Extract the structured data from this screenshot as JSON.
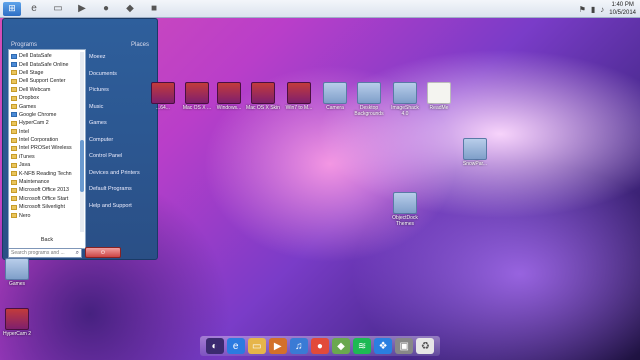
{
  "clock": {
    "time": "1:40 PM",
    "date": "10/5/2014"
  },
  "start_menu": {
    "programs_header": "Programs",
    "places_header": "Places",
    "programs": [
      "Dell DataSafe",
      "Dell DataSafe Online",
      "Dell Stage",
      "Dell Support Center",
      "Dell Webcam",
      "Dropbox",
      "Games",
      "Google Chrome",
      "HyperCam 2",
      "Intel",
      "Intel Corporation",
      "Intel PROSet Wireless",
      "iTunes",
      "Java",
      "K-NFB Reading Techn",
      "Maintenance",
      "Microsoft Office 2013",
      "Microsoft Office Start",
      "Microsoft Silverlight",
      "Nero"
    ],
    "back_label": "Back",
    "search_placeholder": "Search programs and ...",
    "places": [
      "Moeez",
      "Documents",
      "Pictures",
      "Music",
      "Games",
      "Computer",
      "Control Panel",
      "Devices and Printers",
      "Default Programs",
      "Help and Support"
    ]
  },
  "desktop_icons": [
    {
      "label": "...64...",
      "type": "rar"
    },
    {
      "label": "Mac OS X ...",
      "type": "rar"
    },
    {
      "label": "Windows...",
      "type": "rar"
    },
    {
      "label": "Mac OS X Skin",
      "type": "rar"
    },
    {
      "label": "Win7 to M...",
      "type": "rar"
    },
    {
      "label": "Camera",
      "type": "folder"
    },
    {
      "label": "Desktop Backgrounds",
      "type": "folder"
    },
    {
      "label": "ImageShack 4.0",
      "type": "folder"
    },
    {
      "label": "ReadMe",
      "type": "doc"
    },
    {
      "label": "SnowPar...",
      "type": "folder"
    },
    {
      "label": "ObjectDock Themes",
      "type": "folder"
    },
    {
      "label": "Games",
      "type": "folder"
    },
    {
      "label": "HyperCam 2",
      "type": "rar"
    }
  ]
}
